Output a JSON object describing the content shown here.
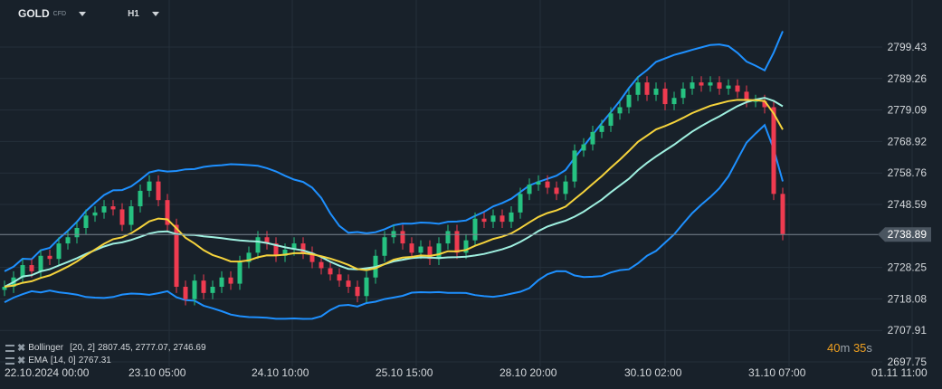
{
  "header": {
    "symbol": "GOLD",
    "instrument_type": "CFD",
    "timeframe": "H1"
  },
  "indicators": [
    {
      "name": "Bollinger",
      "params": "[20, 2]",
      "values": "2807.45,  2777.07,  2746.69"
    },
    {
      "name": "EMA",
      "params": "[14, 0]",
      "values": "2767.31"
    }
  ],
  "timer": {
    "minutes": "40",
    "m": "m",
    "seconds": "35",
    "s": "s"
  },
  "colors": {
    "background": "#18212a",
    "up": "#26c281",
    "down": "#ef3b50",
    "bollinger_outer": "#1e90ff",
    "bollinger_mid": "#9ff0e0",
    "ema": "#f5d33c",
    "grid": "#25303a"
  },
  "chart_data": {
    "type": "candlestick",
    "symbol": "GOLD",
    "ylim": [
      2697.75,
      2809
    ],
    "y_ticks": [
      "2799.43",
      "2789.26",
      "2779.09",
      "2768.92",
      "2758.76",
      "2748.59",
      "2728.25",
      "2718.08",
      "2707.91",
      "2697.75"
    ],
    "x_ticks": [
      "22.10.2024  00:00",
      "23.10  05:00",
      "24.10  10:00",
      "25.10  15:00",
      "28.10  20:00",
      "30.10  02:00",
      "31.10  07:00",
      "01.11  11:00"
    ],
    "current_price": "2738.89",
    "closes": [
      2722,
      2725,
      2729,
      2727,
      2732,
      2731,
      2736,
      2738,
      2741,
      2745,
      2746,
      2748,
      2747,
      2742,
      2748,
      2753,
      2756,
      2750,
      2742,
      2722,
      2718,
      2724,
      2720,
      2722,
      2725,
      2723,
      2730,
      2733,
      2738,
      2736,
      2732,
      2734,
      2736,
      2733,
      2730,
      2728,
      2726,
      2724,
      2722,
      2719,
      2725,
      2732,
      2738,
      2740,
      2736,
      2733,
      2735,
      2731,
      2736,
      2740,
      2733,
      2737,
      2744,
      2743,
      2745,
      2743,
      2746,
      2752,
      2755,
      2756,
      2754,
      2752,
      2756,
      2766,
      2768,
      2772,
      2774,
      2778,
      2780,
      2784,
      2788,
      2784,
      2786,
      2781,
      2783,
      2786,
      2788,
      2787,
      2788,
      2786,
      2787,
      2785,
      2782,
      2782,
      2780,
      2752,
      2739
    ]
  }
}
